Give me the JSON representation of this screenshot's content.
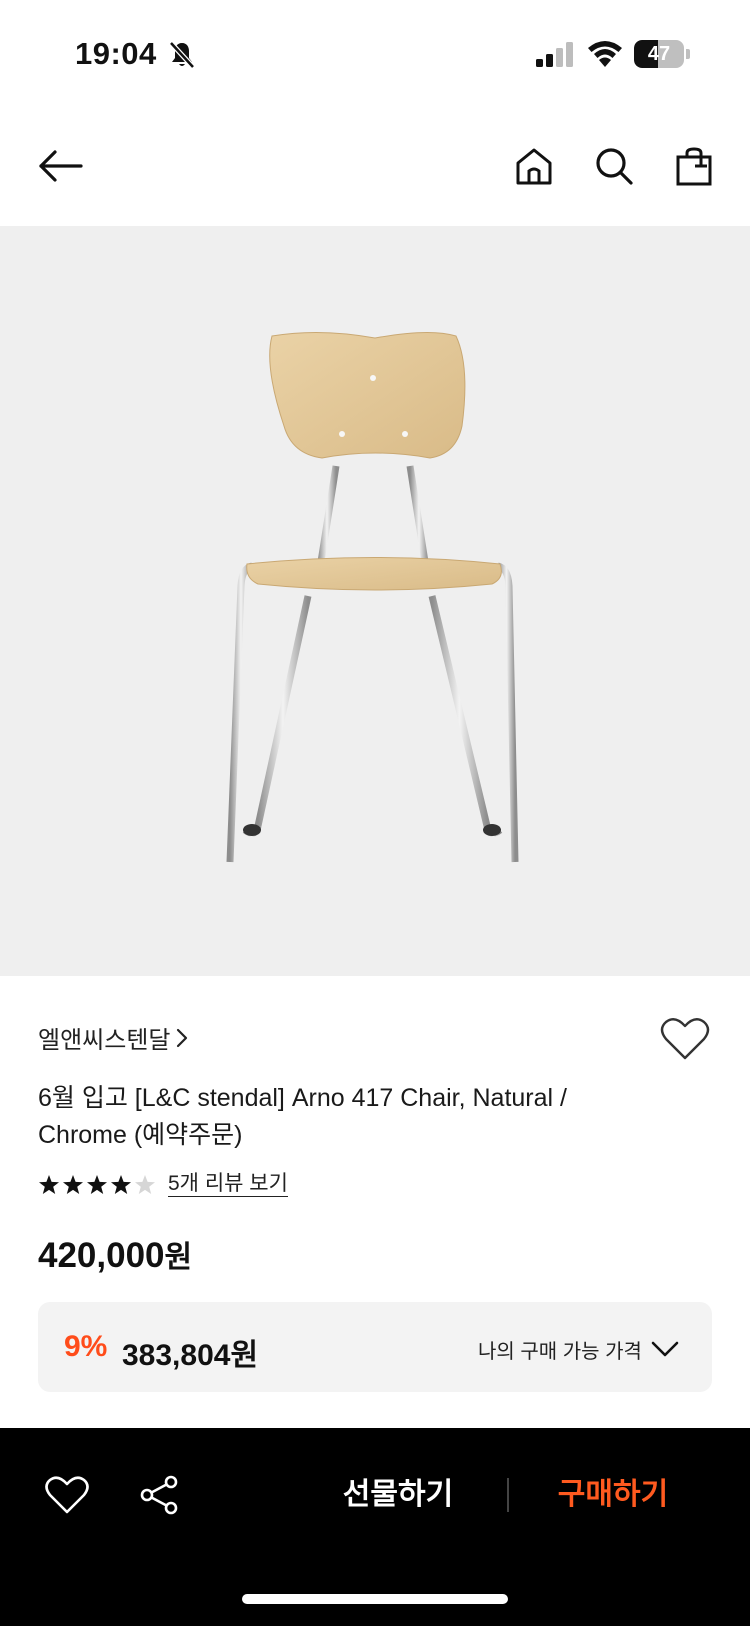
{
  "status_bar": {
    "time": "19:04",
    "battery": "47",
    "battery_level": 0.47
  },
  "nav": {
    "back_icon": "arrow-left-icon",
    "home_icon": "home-icon",
    "search_icon": "search-icon",
    "cart_icon": "shopping-bag-icon"
  },
  "product": {
    "image_description_icon": "chair-image",
    "brand": "엘앤씨스텐달",
    "title": "6월 입고 [L&C stendal] Arno 417 Chair, Natural / Chrome (예약주문)",
    "rating": 4,
    "rating_max": 5,
    "review_link": "5개 리뷰 보기",
    "price": "420,000",
    "price_unit": "원",
    "discount": {
      "rate": "9%",
      "price": "383,804원",
      "label": "나의 구매 가능 가격"
    }
  },
  "bottom_bar": {
    "gift_label": "선물하기",
    "buy_label": "구매하기"
  },
  "colors": {
    "accent": "#ff4c1a",
    "buy": "#ff5a1f",
    "bar_bg": "#000000",
    "image_bg": "#efefef"
  }
}
